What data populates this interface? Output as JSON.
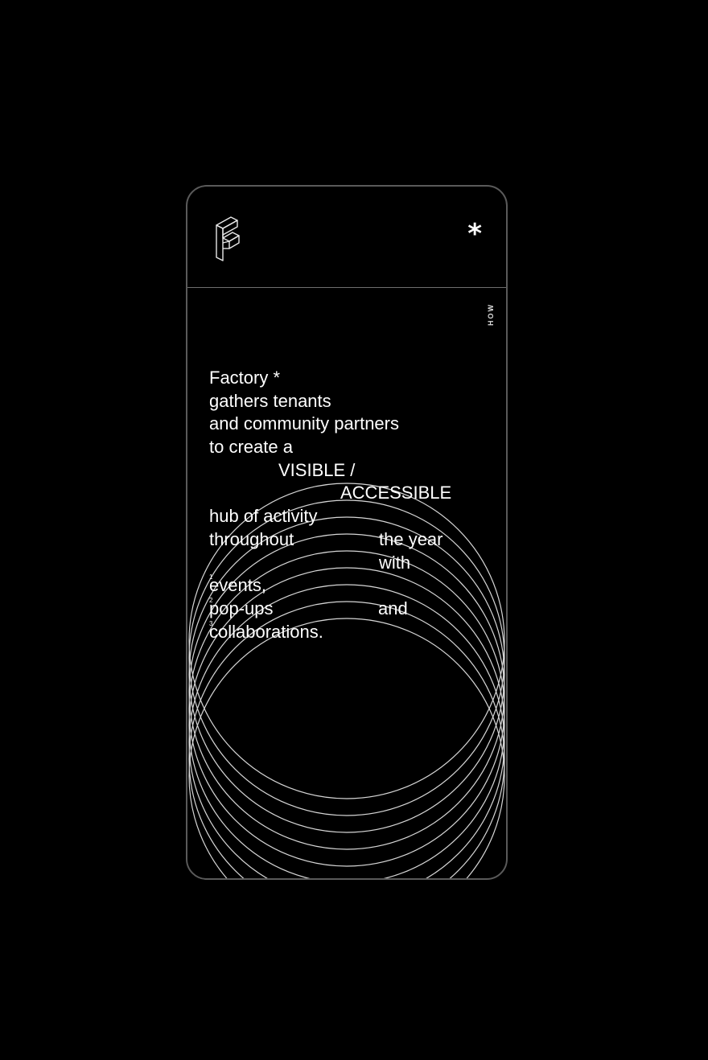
{
  "header": {
    "logo_icon": "factory-f-logo-icon",
    "star_label": "*"
  },
  "side_nav": {
    "label": "HOW"
  },
  "manifesto": {
    "line1": "Factory *",
    "line2": "gathers tenants",
    "line3": "and community partners",
    "line4": "to create a",
    "line5": "VISIBLE /",
    "line6": "ACCESSIBLE",
    "line7": "hub of activity",
    "line8a": "throughout",
    "line8b": "the year",
    "line9": "with",
    "item1_num": "1",
    "item1": "events,",
    "item2_num": "2",
    "item2": "pop-ups",
    "item2_and": "and",
    "item3_num": "3",
    "item3": "collaborations."
  },
  "colors": {
    "background": "#000000",
    "text": "#ffffff",
    "line": "#cfcfcf"
  }
}
